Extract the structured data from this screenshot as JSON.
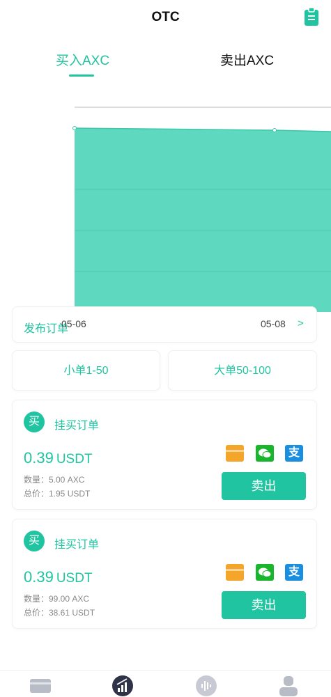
{
  "header": {
    "title": "OTC",
    "clipboard_icon": "clipboard-icon"
  },
  "tabs": [
    {
      "label": "买入AXC",
      "active": true
    },
    {
      "label": "卖出AXC",
      "active": false
    }
  ],
  "chart_data": {
    "type": "area",
    "x": [
      "05-06",
      "05-08"
    ],
    "series": [
      {
        "values": [
          1.0,
          0.98
        ]
      }
    ],
    "grid": true,
    "color": "#5fd8c0"
  },
  "publish": {
    "label": "发布订单",
    "arrow": ">"
  },
  "filters": {
    "small": "小单1-50",
    "big": "大单50-100"
  },
  "orders": [
    {
      "badge": "买",
      "type": "挂买订单",
      "price": "0.39",
      "unit": "USDT",
      "qty": "数量：5.00 AXC",
      "total": "总价：1.95 USDT",
      "button": "卖出",
      "alipay_glyph": "支"
    },
    {
      "badge": "买",
      "type": "挂买订单",
      "price": "0.39",
      "unit": "USDT",
      "qty": "数量：99.00 AXC",
      "total": "总价：38.61 USDT",
      "button": "卖出",
      "alipay_glyph": "支"
    }
  ],
  "nav": [
    "wallet-icon",
    "market-chart-icon",
    "voice-icon",
    "profile-icon"
  ],
  "colors": {
    "accent": "#20c4a0",
    "chart_fill": "#5fd8c0"
  }
}
